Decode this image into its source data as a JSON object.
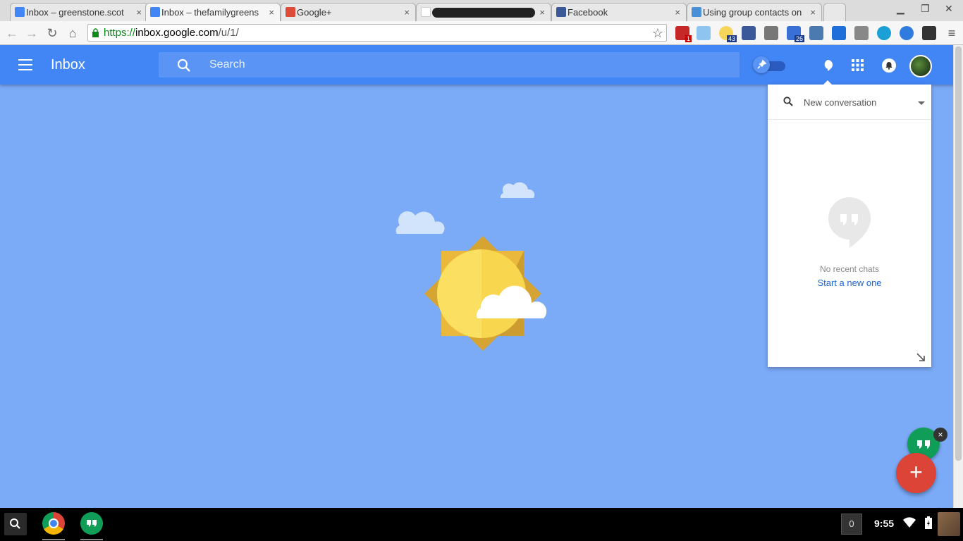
{
  "browser": {
    "tabs": [
      {
        "label": "Inbox – greenstone.scot",
        "close": "×",
        "active": false
      },
      {
        "label": "Inbox – thefamilygreens",
        "close": "×",
        "active": true
      },
      {
        "label": "Google+",
        "close": "×",
        "active": false
      },
      {
        "label": "",
        "close": "×",
        "active": false
      },
      {
        "label": "Facebook",
        "close": "×",
        "active": false
      },
      {
        "label": "Using group contacts on",
        "close": "×",
        "active": false
      }
    ],
    "url_scheme": "https://",
    "url_host": "inbox.google.com",
    "url_path": "/u/1/",
    "ext_badges": {
      "red": "1",
      "weather": "43",
      "blue": "26"
    }
  },
  "app": {
    "title": "Inbox",
    "search_placeholder": "Search"
  },
  "hangouts_panel": {
    "title": "New conversation",
    "empty_text": "No recent chats",
    "start_link": "Start a new one"
  },
  "fab": {
    "compose": "+",
    "close": "×"
  },
  "taskbar": {
    "notifications": "0",
    "time": "9:55"
  },
  "colors": {
    "appbar": "#4285f4",
    "background": "#7baaf7",
    "compose": "#db4437",
    "hangouts": "#0f9d58"
  }
}
